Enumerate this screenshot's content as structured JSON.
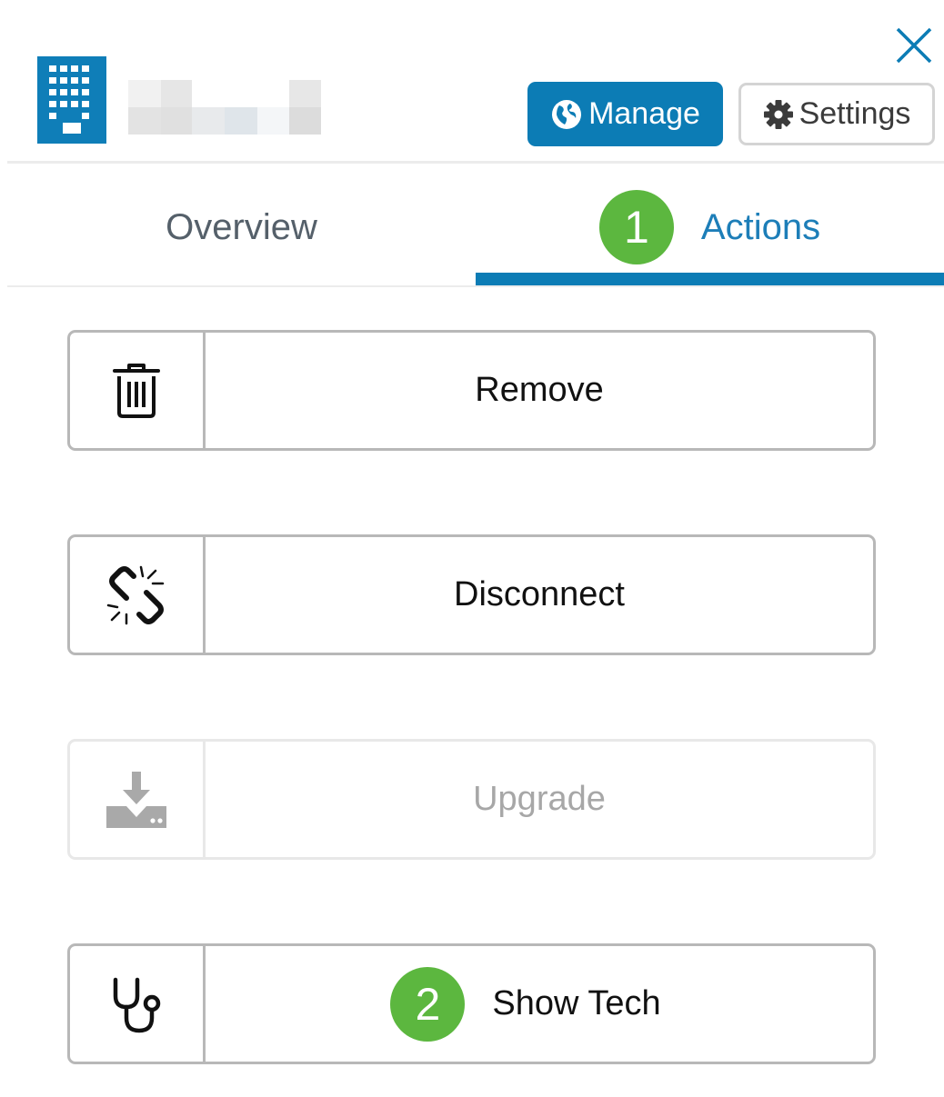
{
  "header": {
    "manage_label": "Manage",
    "settings_label": "Settings"
  },
  "tabs": [
    {
      "label": "Overview",
      "active": false
    },
    {
      "label": "Actions",
      "active": true,
      "badge": "1"
    }
  ],
  "actions": [
    {
      "label": "Remove",
      "icon": "trash-icon",
      "enabled": true
    },
    {
      "label": "Disconnect",
      "icon": "broken-link-icon",
      "enabled": true
    },
    {
      "label": "Upgrade",
      "icon": "download-icon",
      "enabled": false
    },
    {
      "label": "Show Tech",
      "icon": "stethoscope-icon",
      "enabled": true,
      "badge": "2"
    }
  ],
  "colors": {
    "primary": "#0c7cb5",
    "badge": "#5cb73f",
    "active_tab_text": "#1d7eb8"
  }
}
